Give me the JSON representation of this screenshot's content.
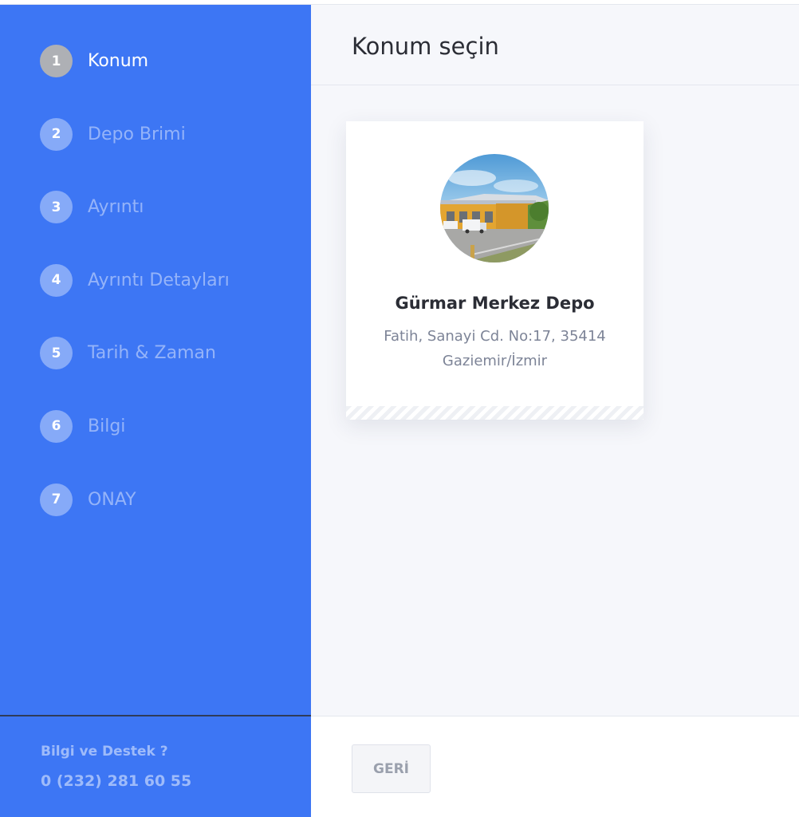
{
  "steps": [
    {
      "number": "1",
      "label": "Konum",
      "active": true
    },
    {
      "number": "2",
      "label": "Depo Brimi",
      "active": false
    },
    {
      "number": "3",
      "label": "Ayrıntı",
      "active": false
    },
    {
      "number": "4",
      "label": "Ayrıntı Detayları",
      "active": false
    },
    {
      "number": "5",
      "label": "Tarih & Zaman",
      "active": false
    },
    {
      "number": "6",
      "label": "Bilgi",
      "active": false
    },
    {
      "number": "7",
      "label": "ONAY",
      "active": false
    }
  ],
  "support": {
    "title": "Bilgi ve Destek ?",
    "phone": "0 (232) 281 60 55"
  },
  "page": {
    "title": "Konum seçin"
  },
  "location_card": {
    "name": "Gürmar Merkez Depo",
    "address_line1": "Fatih, Sanayi Cd. No:17, 35414",
    "address_line2": "Gaziemir/İzmir",
    "photo_icon": "warehouse-photo"
  },
  "footer": {
    "back_label": "GERİ"
  },
  "colors": {
    "sidebar": "#3d76f4",
    "active_step_badge": "#aeb0b5",
    "main_bg": "#f6f7fb"
  }
}
